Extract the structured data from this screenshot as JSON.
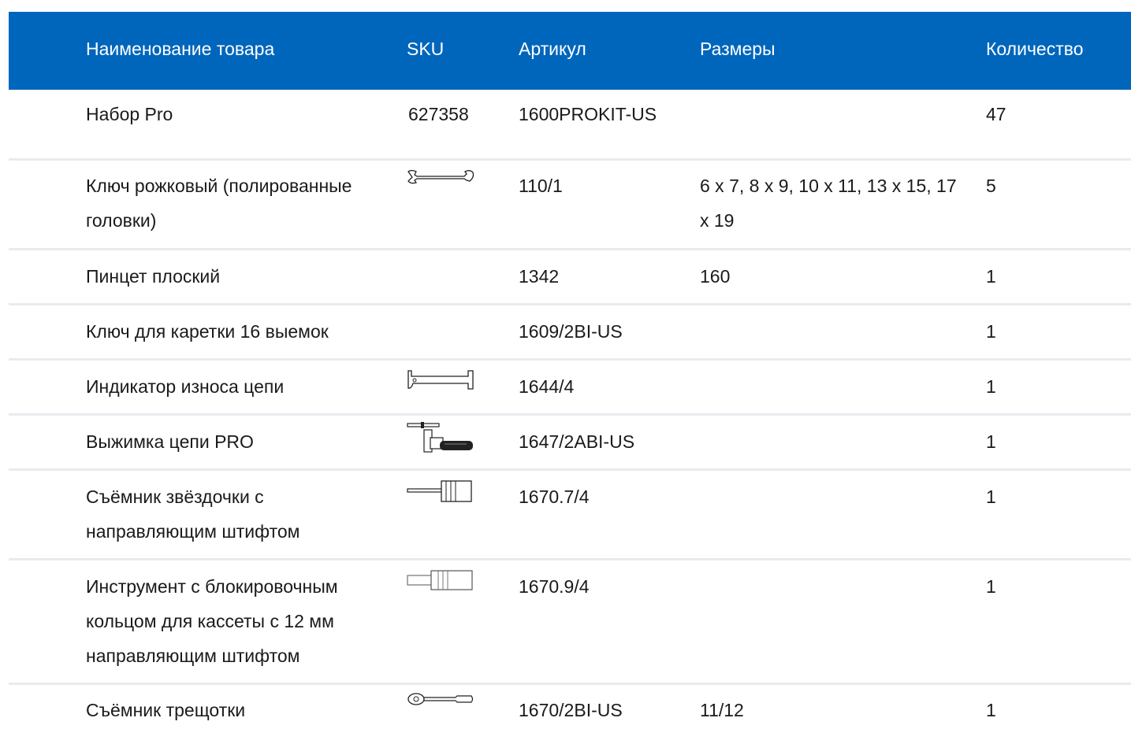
{
  "header": {
    "name": "Наименование товара",
    "sku": "SKU",
    "article": "Артикул",
    "sizes": "Размеры",
    "qty": "Количество"
  },
  "rows": [
    {
      "name": "Набор Pro",
      "sku": "627358",
      "image": null,
      "article": "1600PROKIT-US",
      "sizes": "",
      "qty": "47"
    },
    {
      "name": "Ключ рожковый (полированные головки)",
      "sku": "",
      "image": "open-end-wrench-icon",
      "article": "110/1",
      "sizes": "6 x 7, 8 x 9, 10 x 11, 13 x 15, 17 x 19",
      "qty": "5"
    },
    {
      "name": "Пинцет плоский",
      "sku": "",
      "image": null,
      "article": "1342",
      "sizes": "160",
      "qty": "1"
    },
    {
      "name": "Ключ для каретки 16 выемок",
      "sku": "",
      "image": null,
      "article": "1609/2BI-US",
      "sizes": "",
      "qty": "1"
    },
    {
      "name": "Индикатор износа цепи",
      "sku": "",
      "image": "chain-wear-indicator-icon",
      "article": "1644/4",
      "sizes": "",
      "qty": "1"
    },
    {
      "name": "Выжимка цепи PRO",
      "sku": "",
      "image": "chain-tool-icon",
      "article": "1647/2ABI-US",
      "sizes": "",
      "qty": "1"
    },
    {
      "name": "Съёмник звёздочки с направляющим штифтом",
      "sku": "",
      "image": "sprocket-remover-icon",
      "article": "1670.7/4",
      "sizes": "",
      "qty": "1"
    },
    {
      "name": "Инструмент с блокировочным кольцом для кассеты с 12 мм направляющим штифтом",
      "sku": "",
      "image": "lockring-tool-icon",
      "article": "1670.9/4",
      "sizes": "",
      "qty": "1"
    },
    {
      "name": "Съёмник трещотки",
      "sku": "",
      "image": "ratchet-remover-icon",
      "article": "1670/2BI-US",
      "sizes": "11/12",
      "qty": "1"
    }
  ]
}
